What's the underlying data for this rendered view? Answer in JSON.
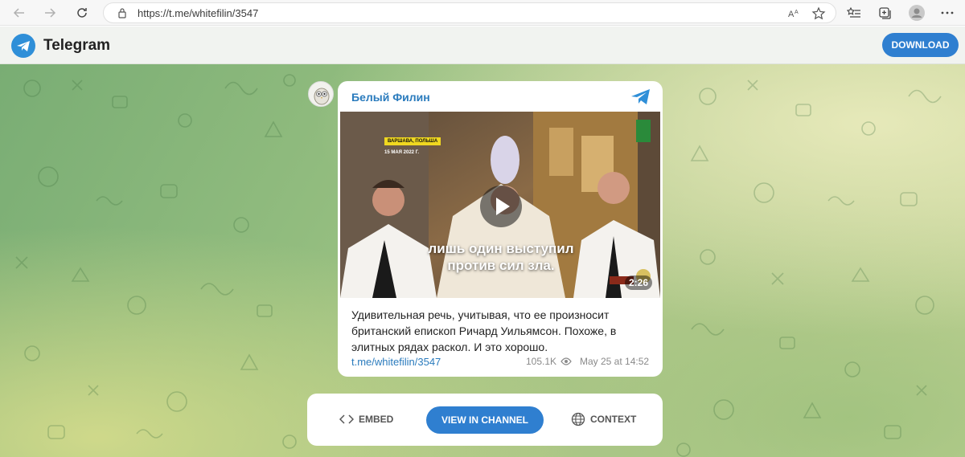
{
  "browser": {
    "url": "https://t.me/whitefilin/3547",
    "icons": [
      "back-arrow-icon",
      "forward-arrow-icon",
      "refresh-icon",
      "lock-icon",
      "read-aloud-icon",
      "favorite-star-icon",
      "favorites-list-icon",
      "collections-icon",
      "profile-icon",
      "more-icon"
    ]
  },
  "header": {
    "title": "Telegram",
    "download_label": "DOWNLOAD",
    "accent": "#2f7fd0"
  },
  "message": {
    "channel_name": "Белый Филин",
    "video": {
      "tag": "ВАРШАВА, ПОЛЬША",
      "date_overlay": "15 МАЯ 2022 Г.",
      "caption_line1": "лишь один выступил",
      "caption_line2": "против сил зла.",
      "duration": "2:26"
    },
    "text": "Удивительная речь, учитывая, что ее произносит британский епископ Ричард Уильямсон. Похоже, в элитных рядах раскол. И это хорошо.",
    "link": "t.me/whitefilin/3547",
    "views": "105.1K",
    "date": "May 25 at 14:52"
  },
  "actions": {
    "embed_label": "EMBED",
    "view_label": "VIEW IN CHANNEL",
    "context_label": "CONTEXT"
  }
}
